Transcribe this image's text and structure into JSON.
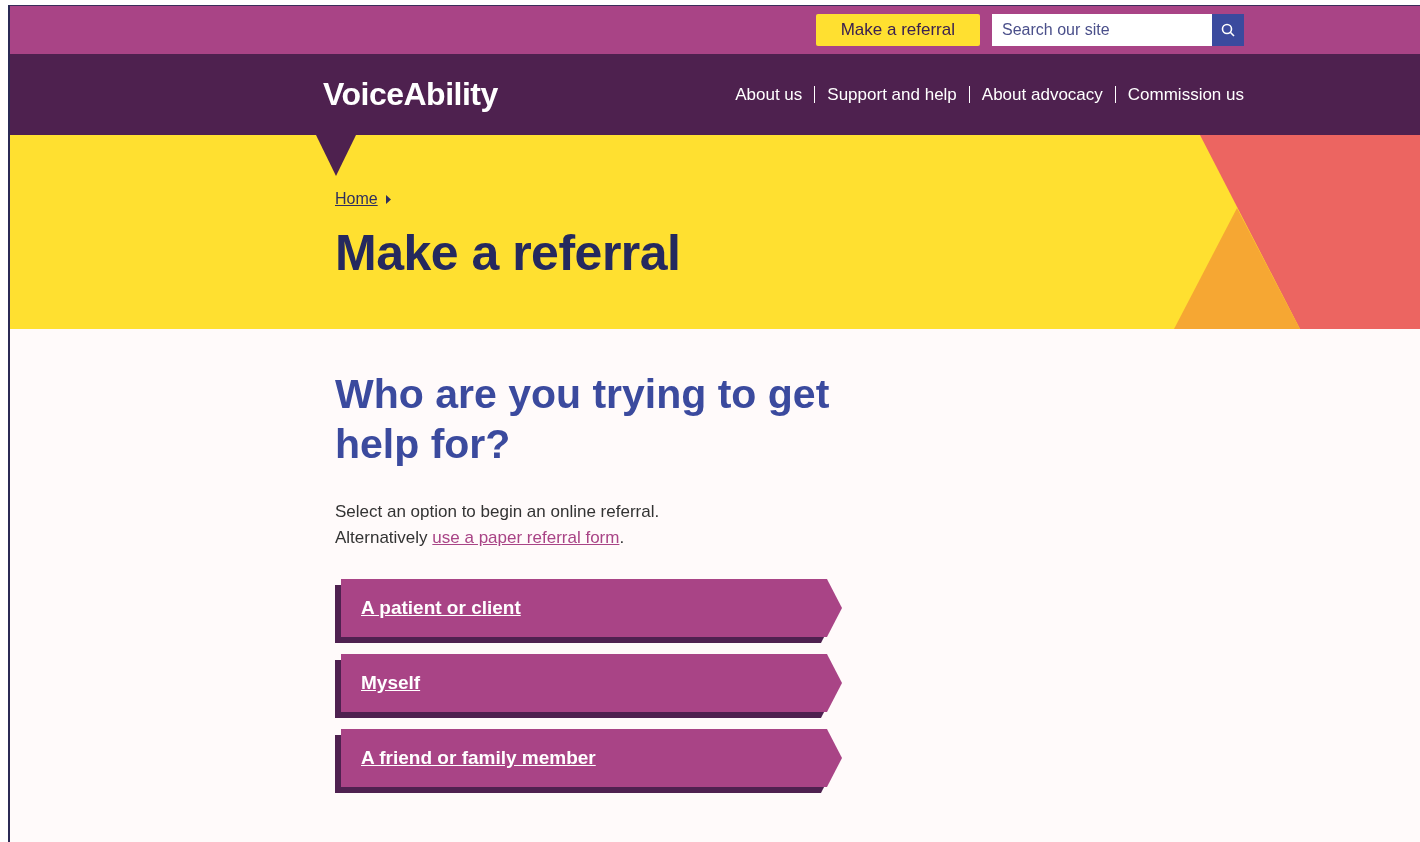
{
  "top_bar": {
    "referral_button": "Make a referral",
    "search": {
      "placeholder": "Search our site"
    }
  },
  "header": {
    "logo": "VoiceAbility",
    "nav": [
      "About us",
      "Support and help",
      "About advocacy",
      "Commission us"
    ]
  },
  "hero": {
    "breadcrumb": [
      {
        "label": "Home"
      }
    ],
    "title": "Make a referral"
  },
  "main": {
    "heading": "Who are you trying to get help for?",
    "intro": "Select an option to begin an online referral.",
    "alt_prefix": "Alternatively ",
    "alt_link": "use a paper referral form",
    "alt_suffix": ".",
    "options": [
      "A patient or client",
      "Myself",
      "A friend or family member"
    ]
  }
}
